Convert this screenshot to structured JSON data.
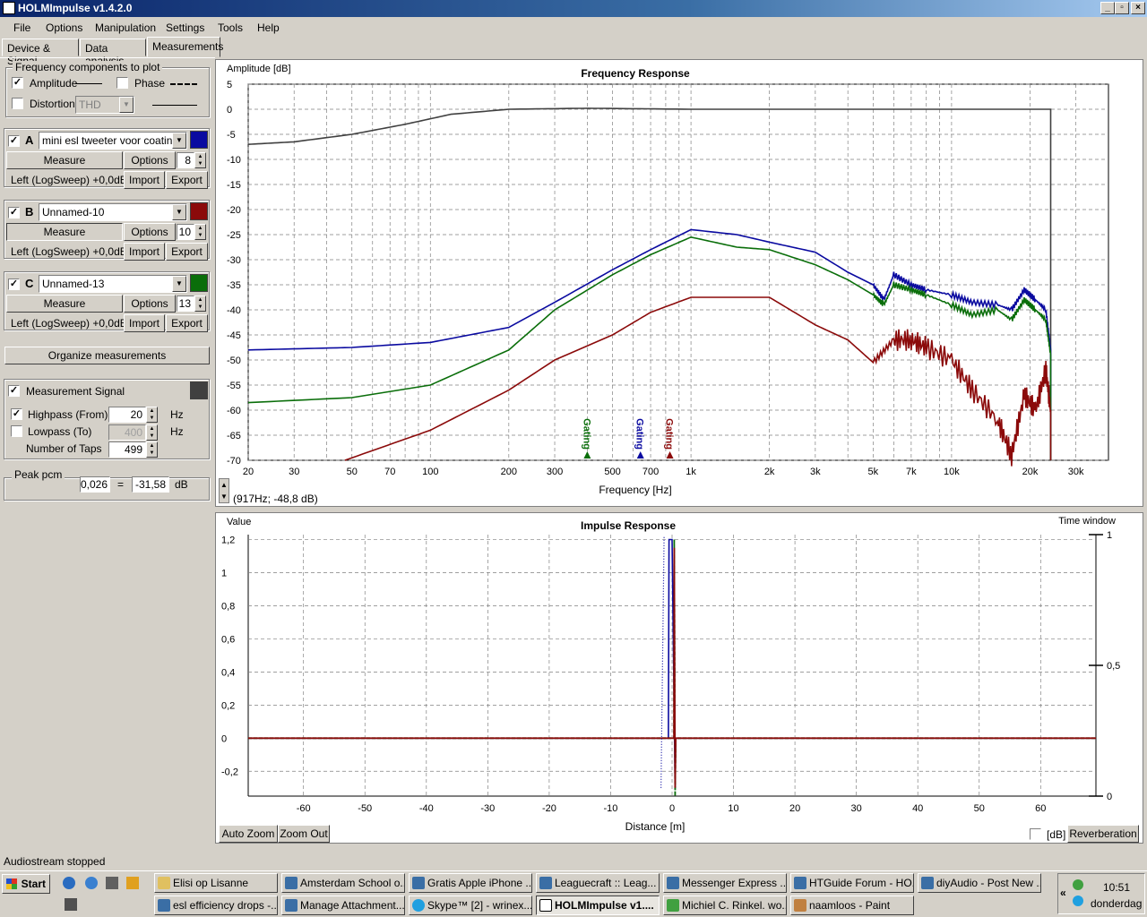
{
  "window": {
    "title": "HOLMImpulse  v1.4.2.0"
  },
  "menu": [
    "File",
    "Options",
    "Manipulation",
    "Settings",
    "Tools",
    "Help"
  ],
  "tabs": [
    "Device & Signal",
    "Data analysis",
    "Measurements"
  ],
  "freq_group": {
    "title": "Frequency components to plot",
    "amplitude": "Amplitude",
    "phase": "Phase",
    "distortion": "Distortion",
    "distortion_type": "THD"
  },
  "channels": [
    {
      "letter": "A",
      "name": "mini esl tweeter voor coating",
      "color": "#0a0aa0",
      "measure": "Measure",
      "options": "Options",
      "count": "8",
      "source": "Left (LogSweep) +0,0dB",
      "import": "Import",
      "export": "Export"
    },
    {
      "letter": "B",
      "name": "Unnamed-10",
      "color": "#8b0a0a",
      "measure": "Measure",
      "options": "Options",
      "count": "10",
      "source": "Left (LogSweep) +0,0dB",
      "import": "Import",
      "export": "Export"
    },
    {
      "letter": "C",
      "name": "Unnamed-13",
      "color": "#0a6e0a",
      "measure": "Measure",
      "options": "Options",
      "count": "13",
      "source": "Left (LogSweep) +0,0dB",
      "import": "Import",
      "export": "Export"
    }
  ],
  "organize": "Organize measurements",
  "signal": {
    "label": "Measurement Signal",
    "color": "#404040",
    "highpass": "Highpass (From)",
    "highpass_val": "20",
    "lowpass": "Lowpass (To)",
    "lowpass_val": "400",
    "hz": "Hz",
    "taps_label": "Number of Taps",
    "taps": "499"
  },
  "peak": {
    "title": "Peak pcm",
    "value": "0,026",
    "eq": "=",
    "db_value": "-31,58",
    "unit": "dB"
  },
  "freq_plot": {
    "ylabel": "Amplitude [dB]",
    "title": "Frequency Response",
    "xlabel": "Frequency [Hz]",
    "yticks": [
      "5",
      "0",
      "-5",
      "-10",
      "-15",
      "-20",
      "-25",
      "-30",
      "-35",
      "-40",
      "-45",
      "-50",
      "-55",
      "-60",
      "-65",
      "-70"
    ],
    "xticks": [
      "20",
      "30",
      "50",
      "70",
      "100",
      "200",
      "300",
      "500",
      "700",
      "1k",
      "2k",
      "3k",
      "5k",
      "7k",
      "10k",
      "20k",
      "30k"
    ],
    "markers": [
      {
        "label": "Gating",
        "color": "#0a6e0a"
      },
      {
        "label": "Gating",
        "color": "#0a0aa0"
      },
      {
        "label": "Gating",
        "color": "#8b0a0a"
      }
    ],
    "cursor": "(917Hz; -48,8 dB)"
  },
  "impulse_plot": {
    "ylabel": "Value",
    "title": "Impulse Response",
    "rlabel": "Time window",
    "xlabel": "Distance [m]",
    "yticks": [
      "1,2",
      "1",
      "0,8",
      "0,6",
      "0,4",
      "0,2",
      "0",
      "-0,2"
    ],
    "xticks": [
      "-60",
      "-50",
      "-40",
      "-30",
      "-20",
      "-10",
      "0",
      "10",
      "20",
      "30",
      "40",
      "50",
      "60"
    ],
    "rticks": [
      "1",
      "0,5",
      "0"
    ],
    "auto_zoom": "Auto Zoom",
    "zoom_out": "Zoom Out",
    "db": "[dB]",
    "reverberation": "Reverberation"
  },
  "status": "Audiostream stopped",
  "taskbar": {
    "start": "Start",
    "row1": [
      "Elisi op Lisanne",
      "Amsterdam School o...",
      "Gratis Apple iPhone ...",
      "Leaguecraft :: Leag...",
      "Messenger Express ...",
      "HTGuide Forum - HO...",
      "diyAudio - Post New ..."
    ],
    "row2": [
      "esl efficiency drops -...",
      "Manage Attachment...",
      "Skype™ [2] - wrinex...",
      "HOLMImpulse  v1....",
      "Michiel C. Rinkel. wo...",
      "naamloos - Paint"
    ],
    "clock": "10:51",
    "day": "donderdag"
  },
  "chart_data": [
    {
      "type": "line",
      "title": "Frequency Response",
      "xlabel": "Frequency [Hz]",
      "ylabel": "Amplitude [dB]",
      "xscale": "log",
      "xlim": [
        20,
        40000
      ],
      "ylim": [
        -70,
        5
      ],
      "grid": true,
      "series": [
        {
          "color": "#404040",
          "x": [
            20,
            30,
            50,
            80,
            120,
            200,
            400,
            1000,
            3000,
            10000,
            24000
          ],
          "y": [
            -7,
            -6.5,
            -5,
            -3,
            -1,
            0,
            0.2,
            0,
            0,
            0,
            0
          ]
        },
        {
          "color": "#0a0aa0",
          "x": [
            20,
            50,
            100,
            200,
            300,
            500,
            700,
            1000,
            1500,
            2000,
            3000,
            4000,
            5000,
            5500,
            6000,
            7000,
            8000,
            10000,
            12000,
            15000,
            17000,
            19000,
            21000,
            23000,
            24000
          ],
          "y": [
            -48,
            -47.5,
            -46.5,
            -43.5,
            -38.5,
            -32,
            -28,
            -24,
            -25,
            -26.5,
            -28.5,
            -32.5,
            -35,
            -38,
            -33,
            -35,
            -36,
            -37,
            -38.5,
            -39,
            -40,
            -36,
            -38,
            -40,
            -48
          ]
        },
        {
          "color": "#0a6e0a",
          "x": [
            20,
            50,
            100,
            200,
            300,
            500,
            700,
            1000,
            1500,
            2000,
            3000,
            4000,
            5000,
            5500,
            6000,
            7000,
            8000,
            10000,
            12000,
            15000,
            17000,
            19000,
            21000,
            23000,
            24000
          ],
          "y": [
            -58.5,
            -57.5,
            -55,
            -48,
            -40,
            -33,
            -29,
            -25.5,
            -27.5,
            -28,
            -31,
            -34,
            -37,
            -39,
            -35,
            -36,
            -37,
            -39,
            -41,
            -40,
            -42,
            -38,
            -40,
            -42,
            -49
          ]
        },
        {
          "color": "#8b0a0a",
          "x": [
            47,
            100,
            200,
            300,
            500,
            700,
            1000,
            1500,
            2000,
            3000,
            4000,
            5000,
            6000,
            7000,
            8000,
            10000,
            12000,
            15000,
            17000,
            19000,
            21000,
            23000,
            24000
          ],
          "y": [
            -70,
            -64,
            -56,
            -50,
            -45,
            -40.5,
            -37.5,
            -37.5,
            -37.5,
            -43,
            -46,
            -50.5,
            -46,
            -46,
            -47.5,
            -50,
            -56,
            -62,
            -69,
            -57,
            -60,
            -52,
            -60
          ]
        }
      ]
    },
    {
      "type": "line",
      "title": "Impulse Response",
      "xlabel": "Distance [m]",
      "ylabel": "Value",
      "xlim": [
        -69,
        69
      ],
      "ylim": [
        -0.35,
        1.23
      ],
      "grid": true,
      "series": [
        {
          "color": "#0a0aa0",
          "x": [
            -69,
            -0.6,
            -0.5,
            0,
            0.5,
            0.6,
            69
          ],
          "y": [
            0,
            0,
            1.2,
            1.2,
            -0.3,
            0,
            0
          ]
        },
        {
          "color": "#0a6e0a",
          "x": [
            -69,
            0.3,
            0.35,
            0.5,
            0.6,
            69
          ],
          "y": [
            0,
            0,
            1.2,
            -0.35,
            0,
            0
          ]
        },
        {
          "color": "#8b0a0a",
          "x": [
            -69,
            0.3,
            0.35,
            0.5,
            0.6,
            69
          ],
          "y": [
            0,
            0,
            1.15,
            -0.3,
            0,
            0
          ]
        }
      ]
    }
  ]
}
